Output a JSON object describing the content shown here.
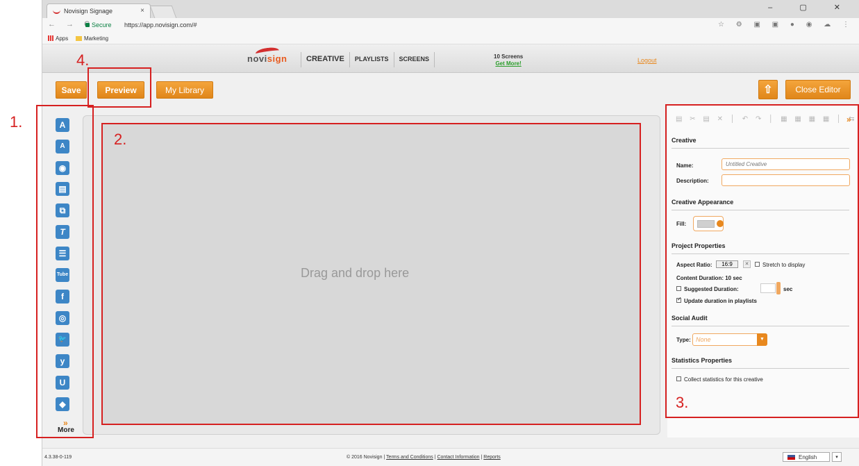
{
  "browser": {
    "tab_title": "Novisign Signage",
    "tab_close": "×",
    "window_controls": "–  ▢  ✕",
    "nav": "← → C",
    "secure_label": "Secure",
    "url": "https://app.novisign.com/#",
    "address_icons": "☆ ⚙ ▣ ▣ ● ◉ ☁ ⋮",
    "bookmarks": [
      "Apps",
      "Marketing"
    ]
  },
  "header": {
    "logo_text_a": "novi",
    "logo_text_b": "sign",
    "nav": [
      "CREATIVE",
      "PLAYLISTS",
      "SCREENS"
    ],
    "screens_count": "10 Screens",
    "get_more": "Get More!",
    "logout": "Logout"
  },
  "toolbar": {
    "save": "Save",
    "preview": "Preview",
    "library": "My Library",
    "upload_icon": "⇧",
    "close_editor": "Close Editor"
  },
  "tools": [
    "A",
    "A",
    "◉",
    "▤",
    "⧉",
    "T",
    "☰",
    "Tube",
    "f",
    "◎",
    "🐦",
    "y",
    "U",
    "◆"
  ],
  "tool_names": [
    "text-tool-icon",
    "textbox-tool-icon",
    "image-tool-icon",
    "video-tool-icon",
    "slideshow-tool-icon",
    "ticker-tool-icon",
    "rss-tool-icon",
    "youtube-tool-icon",
    "facebook-tool-icon",
    "instagram-tool-icon",
    "twitter-tool-icon",
    "yammer-tool-icon",
    "ustream-tool-icon",
    "widget-tool-icon"
  ],
  "more": {
    "arrow": "»",
    "label": "More"
  },
  "canvas": {
    "drop_text": "Drag and drop here"
  },
  "panel": {
    "tools_icons": "▤ ✂ ▤ ✕ │ ↶ ↷ │ ▦ ▦ ▦ ▦ │ ⇆",
    "expand": "»",
    "creative_title": "Creative",
    "name_label": "Name:",
    "name_placeholder": "Untitled Creative",
    "description_label": "Description:",
    "appearance_title": "Creative Appearance",
    "fill_label": "Fill:",
    "project_title": "Project Properties",
    "aspect_label": "Aspect Ratio:",
    "aspect_value": "16:9",
    "aspect_clear": "✕",
    "stretch_label": "Stretch to display",
    "content_duration": "Content Duration: 10 sec",
    "suggested_label": "Suggested Duration:",
    "sec_label": "sec",
    "update_label": "Update duration in playlists",
    "social_title": "Social Audit",
    "type_label": "Type:",
    "type_value": "None",
    "type_dd": "▼",
    "stats_title": "Statistics Properties",
    "collect_label": "Collect statistics for this creative"
  },
  "footer": {
    "version": "4.3.38-0-119",
    "copyright": "© 2016 Novisign | ",
    "terms": "Terms and Conditions",
    "sep1": " | ",
    "contact": "Contact Information",
    "sep2": " | ",
    "reports": "Reports",
    "language": "English",
    "lang_dd": "▾"
  },
  "annotations": [
    "1.",
    "2.",
    "3.",
    "4."
  ],
  "colors": {
    "accent": "#e8881e",
    "annotation": "#d62020",
    "tool_blue": "#3d86c6"
  }
}
